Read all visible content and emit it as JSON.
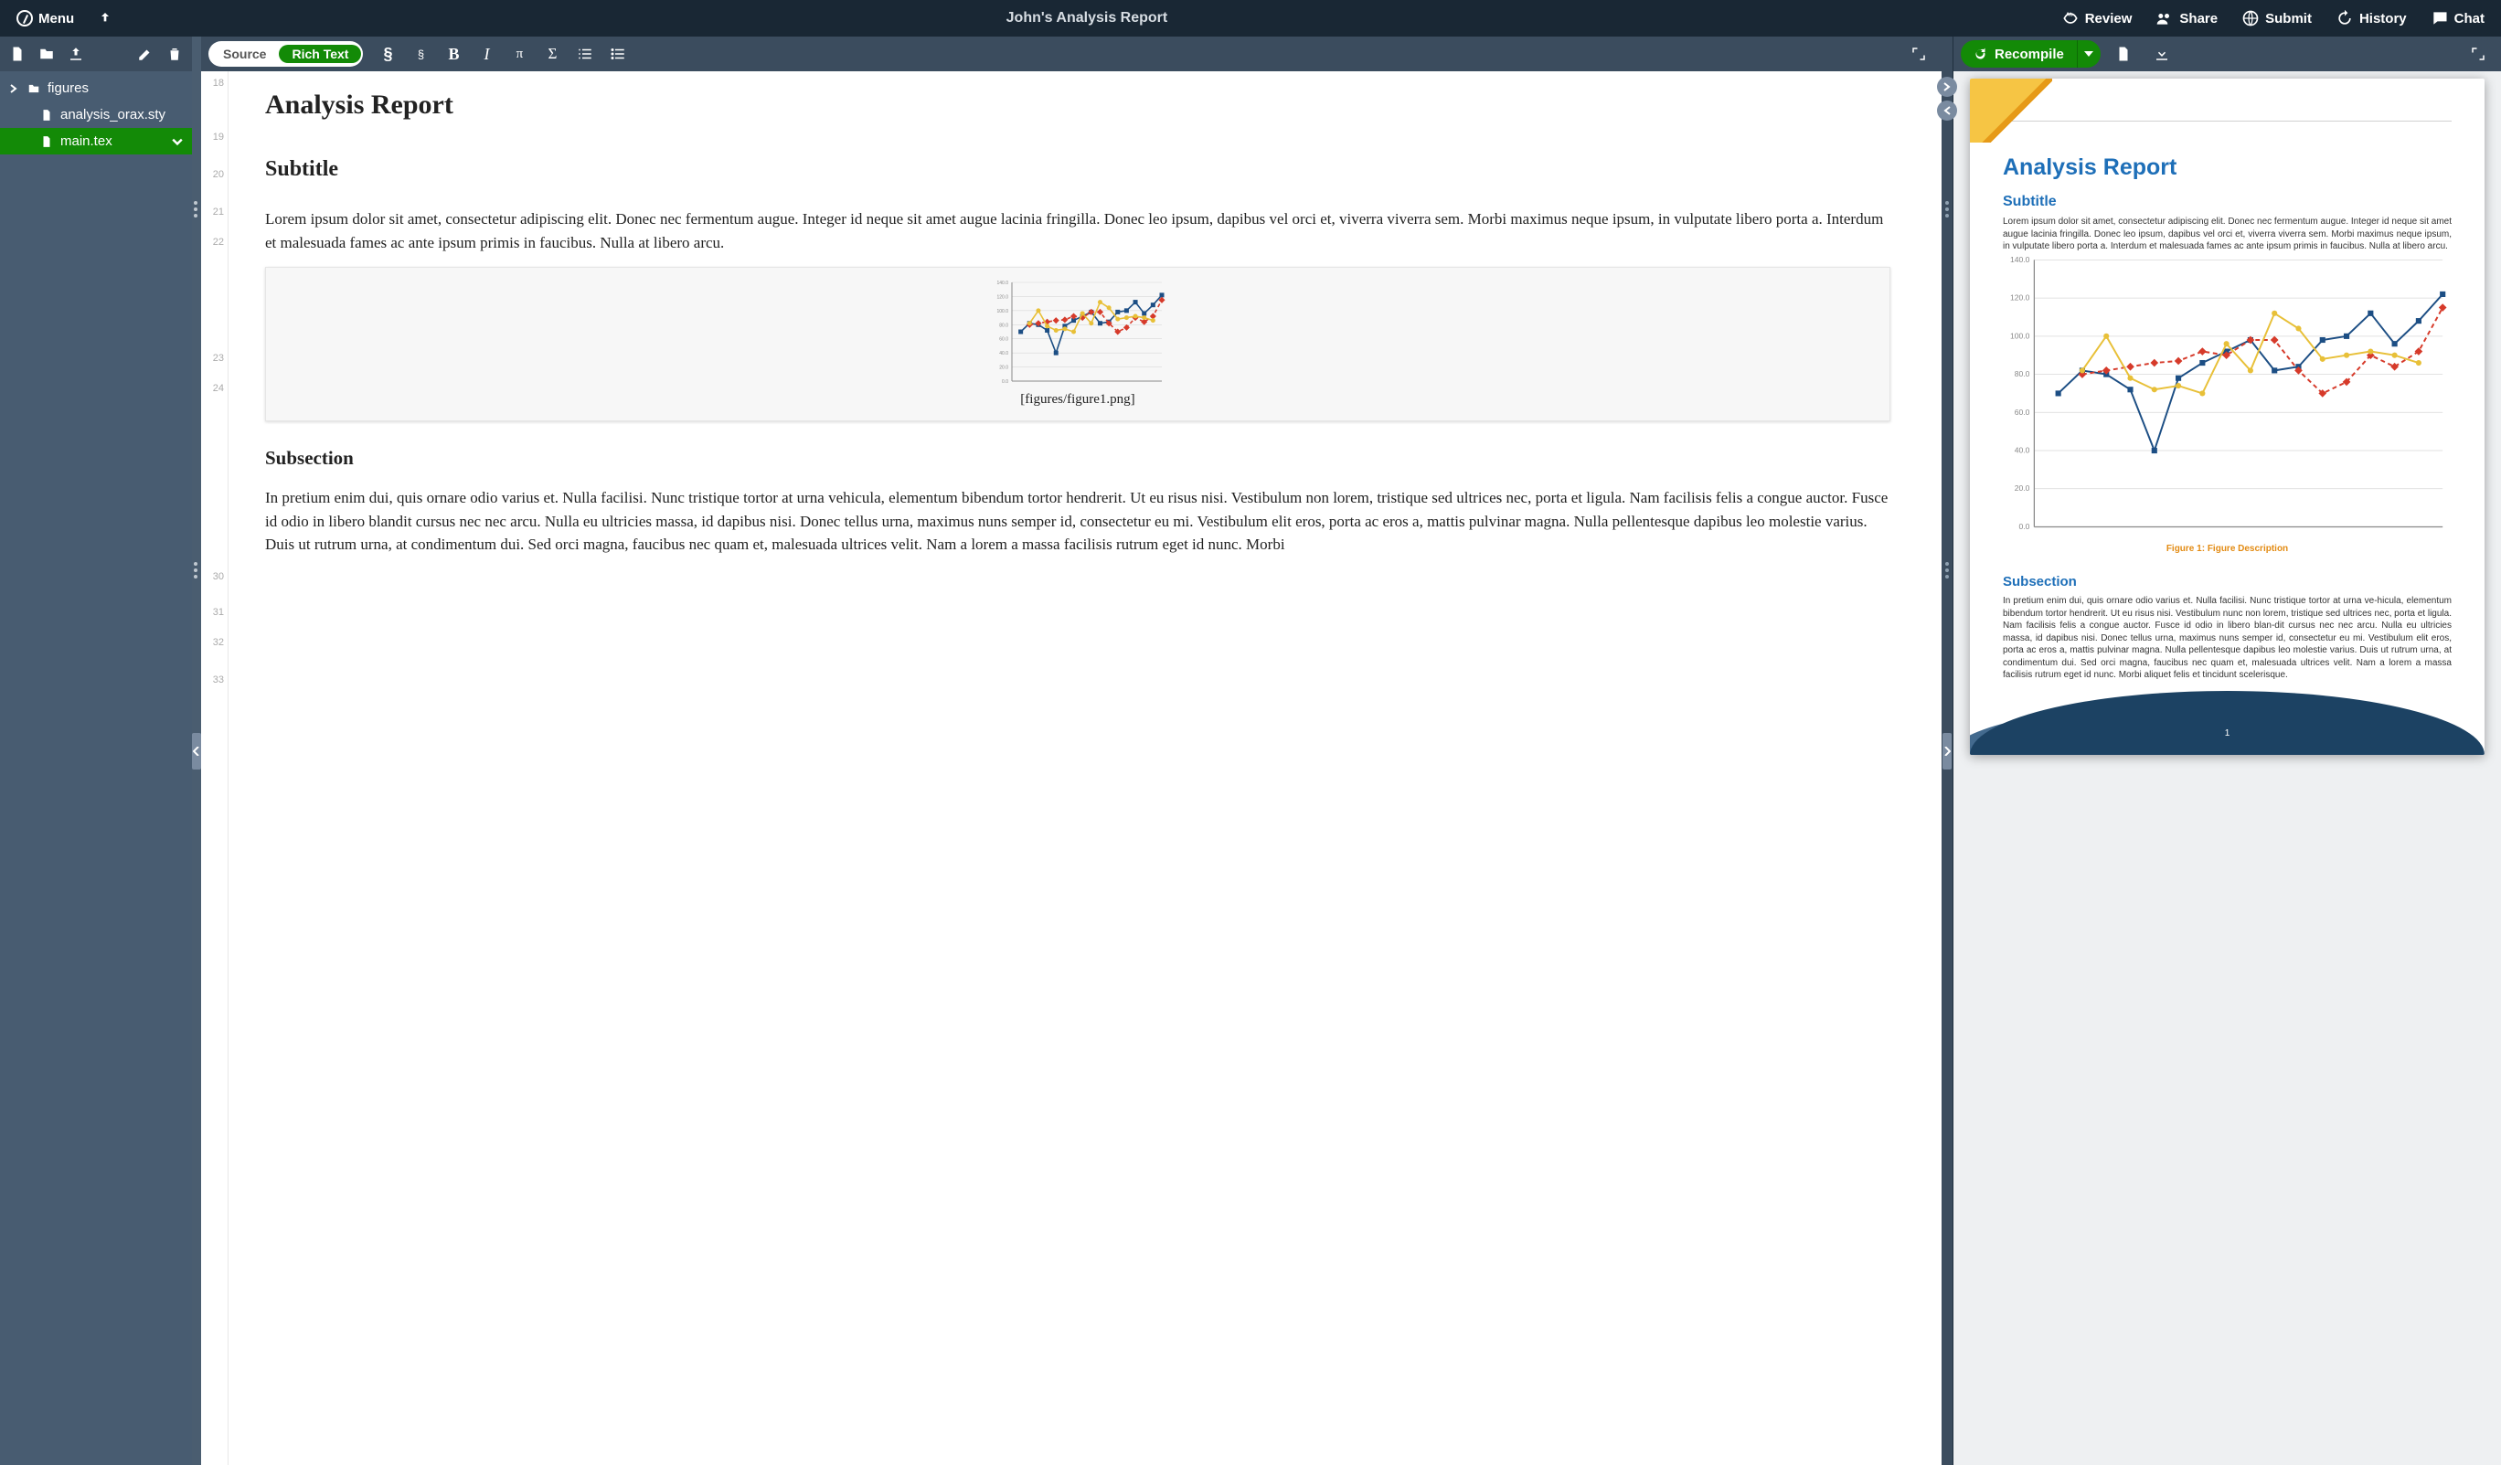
{
  "header": {
    "menu_label": "Menu",
    "project_title": "John's Analysis Report",
    "right_items": [
      {
        "label": "Review",
        "icon": "review"
      },
      {
        "label": "Share",
        "icon": "share"
      },
      {
        "label": "Submit",
        "icon": "submit"
      },
      {
        "label": "History",
        "icon": "history"
      },
      {
        "label": "Chat",
        "icon": "chat"
      }
    ]
  },
  "file_tree": {
    "items": [
      {
        "label": "figures",
        "type": "folder",
        "expandable": true
      },
      {
        "label": "analysis_orax.sty",
        "type": "file"
      },
      {
        "label": "main.tex",
        "type": "file",
        "active": true
      }
    ]
  },
  "editor_toolbar": {
    "mode_source": "Source",
    "mode_rich": "Rich Text"
  },
  "editor": {
    "line_numbers": [
      18,
      19,
      20,
      21,
      22,
      23,
      24,
      30,
      31,
      32,
      33
    ],
    "title": "Analysis Report",
    "subtitle": "Subtitle",
    "para1": "Lorem ipsum dolor sit amet, consectetur adipiscing elit. Donec nec fermentum augue. Integer id neque sit amet augue lacinia fringilla. Donec leo ipsum, dapibus vel orci et, viverra viverra sem. Morbi maximus neque ipsum, in vulputate libero porta a. Interdum et malesuada fames ac ante ipsum primis in faucibus. Nulla at libero arcu.",
    "figure_path": "[figures/figure1.png]",
    "subsection": "Subsection",
    "para2": "In pretium enim dui, quis ornare odio varius et. Nulla facilisi. Nunc tristique tortor at urna vehicula, elementum bibendum tortor hendrerit. Ut eu risus nisi. Vestibulum non lorem, tristique sed ultrices nec, porta et ligula. Nam facilisis felis a congue auctor. Fusce id odio in libero blandit cursus nec nec arcu. Nulla eu ultricies massa, id dapibus nisi. Donec tellus urna, maximus nuns semper id, consectetur eu mi. Vestibulum elit eros, porta ac eros a, mattis pulvinar magna. Nulla pellentesque dapibus leo molestie varius. Duis ut rutrum urna, at condimentum dui. Sed orci magna, faucibus nec quam et, malesuada ultrices velit. Nam a lorem a massa facilisis rutrum eget id nunc. Morbi"
  },
  "preview_toolbar": {
    "recompile_label": "Recompile"
  },
  "preview": {
    "doc_title": "Analysis Report",
    "subtitle": "Subtitle",
    "para1": "Lorem ipsum dolor sit amet, consectetur adipiscing elit. Donec nec fermentum augue. Integer id neque sit amet augue lacinia fringilla. Donec leo ipsum, dapibus vel orci et, viverra viverra sem. Morbi maximus neque ipsum, in vulputate libero porta a. Interdum et malesuada fames ac ante ipsum primis in faucibus. Nulla at libero arcu.",
    "figure_caption": "Figure 1: Figure Description",
    "subsection": "Subsection",
    "para2": "In pretium enim dui, quis ornare odio varius et. Nulla facilisi. Nunc tristique tortor at urna ve-hicula, elementum bibendum tortor hendrerit. Ut eu risus nisi. Vestibulum nunc non lorem, tristique sed ultrices nec, porta et ligula. Nam facilisis felis a congue auctor. Fusce id odio in libero blan-dit cursus nec nec arcu. Nulla eu ultricies massa, id dapibus nisi. Donec tellus urna, maximus nuns semper id, consectetur eu mi. Vestibulum elit eros, porta ac eros a, mattis pulvinar magna. Nulla pellentesque dapibus leo molestie varius. Duis ut rutrum urna, at condimentum dui. Sed orci magna, faucibus nec quam et, malesuada ultrices velit. Nam a lorem a massa facilisis rutrum eget id nunc. Morbi aliquet felis et tincidunt scelerisque.",
    "page_number": "1"
  },
  "chart_data": {
    "type": "line",
    "y_ticks": [
      0,
      20,
      40,
      60,
      80,
      100,
      120,
      140
    ],
    "ylim": [
      0,
      140
    ],
    "x": [
      1,
      2,
      3,
      4,
      5,
      6,
      7,
      8,
      9,
      10,
      11,
      12,
      13,
      14,
      15,
      16,
      17,
      18
    ],
    "series": [
      {
        "name": "blue",
        "color": "#1c4e84",
        "style": "solid",
        "marker": "square",
        "values": [
          null,
          70,
          82,
          80,
          72,
          40,
          78,
          86,
          92,
          98,
          82,
          84,
          98,
          100,
          112,
          96,
          108,
          122
        ]
      },
      {
        "name": "red",
        "color": "#d63a2a",
        "style": "dash",
        "marker": "diamond",
        "values": [
          null,
          null,
          80,
          82,
          84,
          86,
          87,
          92,
          90,
          98,
          98,
          82,
          70,
          76,
          90,
          84,
          92,
          115
        ]
      },
      {
        "name": "yellow",
        "color": "#e8c038",
        "style": "solid",
        "marker": "circle",
        "values": [
          null,
          null,
          82,
          100,
          78,
          72,
          74,
          70,
          96,
          82,
          112,
          104,
          88,
          90,
          92,
          90,
          86,
          null
        ]
      }
    ]
  }
}
